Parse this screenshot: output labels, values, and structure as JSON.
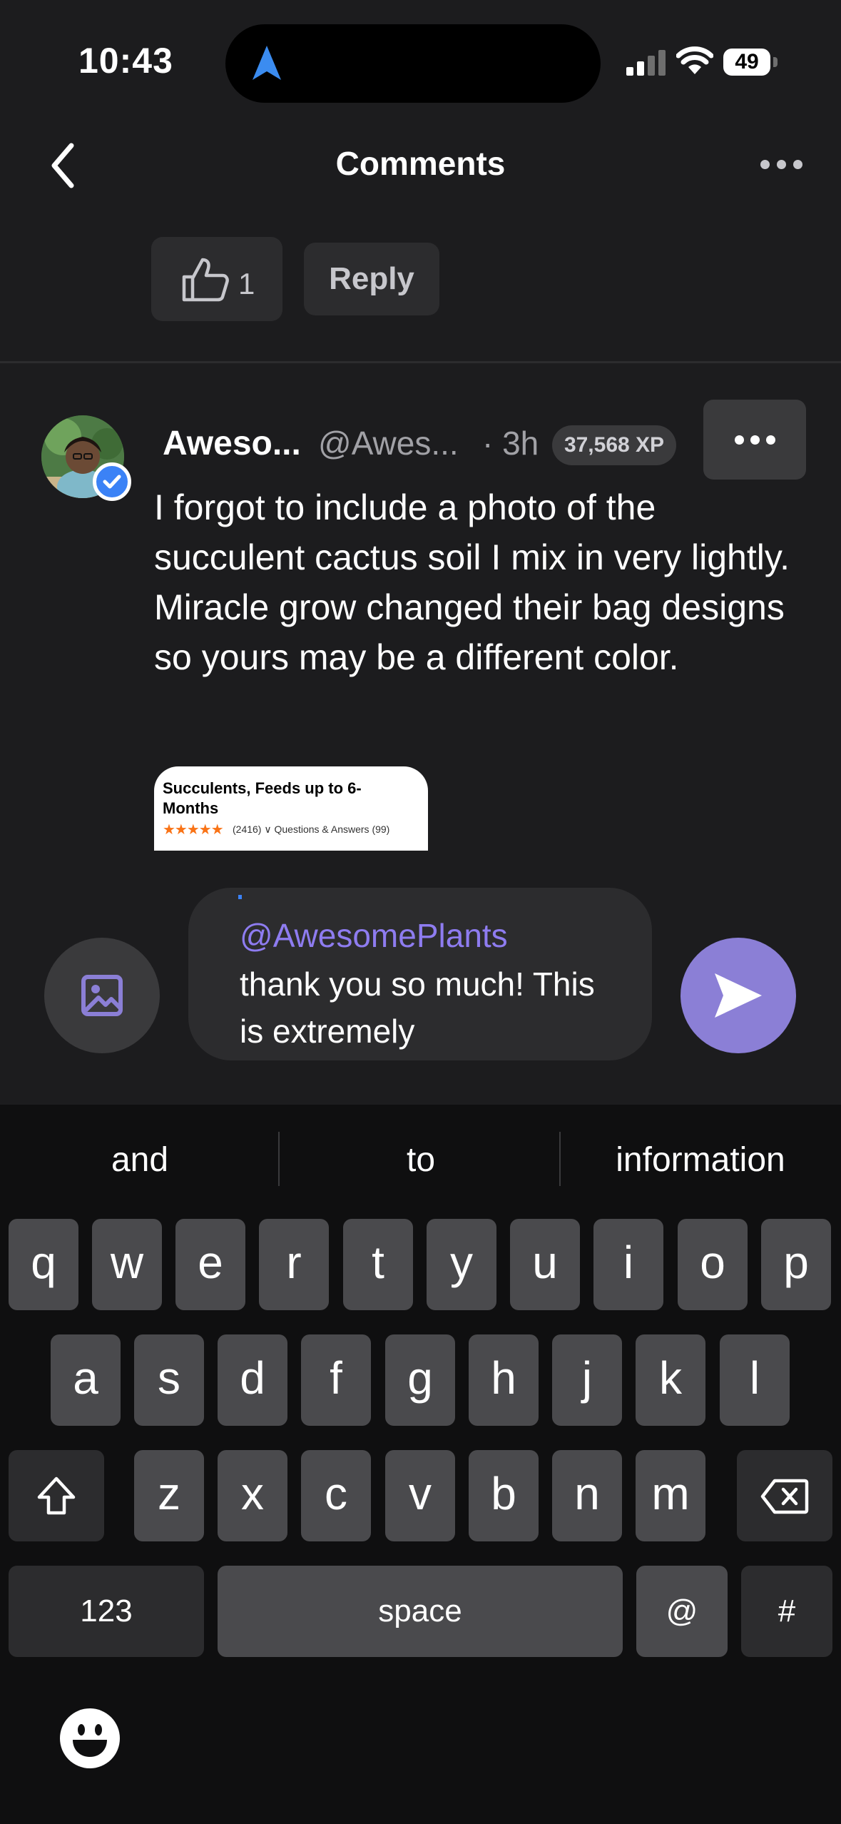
{
  "status_bar": {
    "time": "10:43",
    "battery": "49"
  },
  "nav": {
    "title": "Comments"
  },
  "previous_comment": {
    "like_count": "1",
    "reply_label": "Reply"
  },
  "comment": {
    "author_name": "Aweso...",
    "author_handle": "@Awes...",
    "time": "· 3h",
    "xp": "37,568 XP",
    "body": "I forgot to include a photo of the succulent cactus soil I mix in very lightly. Miracle grow changed their bag designs so yours may be a different color.",
    "attachment": {
      "line1": "Succulents, Feeds up to 6-",
      "line2": "Months",
      "stars": "★★★★★",
      "rating_count": "(2416)",
      "qa_text": "Questions & Answers (99)"
    }
  },
  "composer": {
    "mention": "@AwesomePlants",
    "text": "thank you so much! This is extremely"
  },
  "keyboard": {
    "suggestions": [
      "and",
      "to",
      "information"
    ],
    "row1": [
      "q",
      "w",
      "e",
      "r",
      "t",
      "y",
      "u",
      "i",
      "o",
      "p"
    ],
    "row2": [
      "a",
      "s",
      "d",
      "f",
      "g",
      "h",
      "j",
      "k",
      "l"
    ],
    "row3": [
      "z",
      "x",
      "c",
      "v",
      "b",
      "n",
      "m"
    ],
    "numbers_label": "123",
    "space_label": "space",
    "at_label": "@",
    "hash_label": "#"
  },
  "colors": {
    "accent": "#8b7fd6",
    "mention": "#8e7cf0",
    "background": "#1c1c1e",
    "verified": "#3b82f6"
  },
  "icons": {
    "back": "chevron-left-icon",
    "more": "ellipsis-icon",
    "like": "thumbs-up-icon",
    "image": "image-icon",
    "send": "send-icon",
    "shift": "shift-icon",
    "delete": "backspace-icon",
    "emoji": "emoji-icon"
  }
}
